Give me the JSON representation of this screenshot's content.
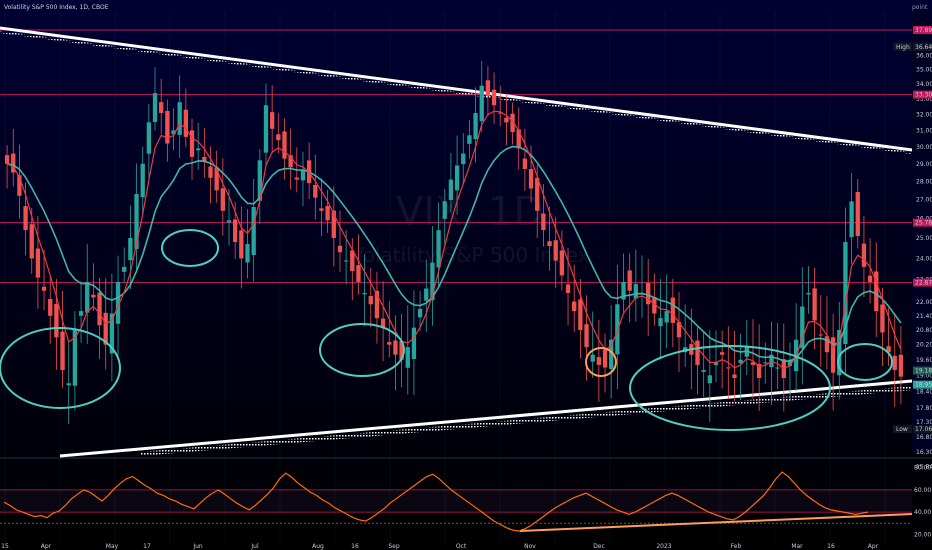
{
  "header": {
    "title": "Volatility S&P 500 Index, 1D, CBOE",
    "scale_label": "point"
  },
  "watermark": {
    "symbol": "VIX, 1D",
    "name": "Volatility S&P 500 Index"
  },
  "colors": {
    "bg_top": "#000033",
    "bg_bottom": "#000000",
    "candle_up": "#26a69a",
    "candle_down": "#ef5350",
    "ema_fast": "#f23645",
    "ema_slow": "#3fb8a5",
    "rsi": "#ff6d00",
    "hline": "#c2185b",
    "annot": "#4dd0c3",
    "annot_orange": "#ff9e59"
  },
  "chart_data": {
    "type": "candlestick",
    "title": "Volatility S&P 500 Index, 1D, CBOE",
    "y_range": [
      16.3,
      37.89
    ],
    "y_ticks": [
      36.64,
      36.0,
      35.0,
      34.0,
      33.3,
      33.0,
      32.0,
      31.0,
      30.0,
      29.0,
      28.0,
      27.0,
      26.0,
      25.0,
      24.0,
      23.0,
      22.0,
      21.4,
      20.8,
      20.2,
      19.6,
      19.0,
      18.4,
      17.8,
      17.3,
      16.8,
      16.3,
      15.84
    ],
    "x_ticks": [
      "15",
      "Apr",
      "May",
      "17",
      "Jun",
      "Jul",
      "Aug",
      "16",
      "Sep",
      "Oct",
      "Nov",
      "Dec",
      "2023",
      "Feb",
      "Mar",
      "16",
      "Apr"
    ],
    "badges": [
      {
        "value": "37.89",
        "kind": "hline"
      },
      {
        "label": "High",
        "value": "36.64",
        "kind": "high"
      },
      {
        "value": "33.30",
        "kind": "hline"
      },
      {
        "value": "25.78",
        "kind": "hline"
      },
      {
        "value": "22.87",
        "kind": "hline"
      },
      {
        "value": "19.18",
        "kind": "price"
      },
      {
        "value": "18.95",
        "kind": "last"
      },
      {
        "label": "Low",
        "value": "17.06",
        "kind": "low"
      }
    ],
    "horizontal_lines": [
      37.89,
      33.3,
      25.78,
      22.87
    ],
    "ohlc_close": [
      29.0,
      28.5,
      27.2,
      25.4,
      24.0,
      23.1,
      22.5,
      21.4,
      20.5,
      19.2,
      18.7,
      20.8,
      21.6,
      22.9,
      22.2,
      21.0,
      20.2,
      21.5,
      22.9,
      23.6,
      25.0,
      27.3,
      29.0,
      31.5,
      33.4,
      32.1,
      30.2,
      31.0,
      32.8,
      30.6,
      29.4,
      29.9,
      29.1,
      28.2,
      27.5,
      26.4,
      25.9,
      24.8,
      24.0,
      24.7,
      26.6,
      29.2,
      32.6,
      31.1,
      30.4,
      29.3,
      28.8,
      28.1,
      28.6,
      27.9,
      27.1,
      26.4,
      25.9,
      25.0,
      24.3,
      23.9,
      23.4,
      22.9,
      22.4,
      21.9,
      21.3,
      20.9,
      20.2,
      19.8,
      19.6,
      20.1,
      20.9,
      21.7,
      22.6,
      23.8,
      25.4,
      26.9,
      28.1,
      28.9,
      29.6,
      30.7,
      32.1,
      33.9,
      33.2,
      32.6,
      32.1,
      31.5,
      30.9,
      29.9,
      28.7,
      27.6,
      26.4,
      25.4,
      24.6,
      23.9,
      23.2,
      22.4,
      21.6,
      20.8,
      20.1,
      19.8,
      19.4,
      19.3,
      20.4,
      21.9,
      22.9,
      22.5,
      22.8,
      22.4,
      21.9,
      21.5,
      21.3,
      21.6,
      21.1,
      20.5,
      20.1,
      19.8,
      19.4,
      19.2,
      19.0,
      19.5,
      19.8,
      19.3,
      18.9,
      19.6,
      20.1,
      19.4,
      18.9,
      19.5,
      19.8,
      19.3,
      18.9,
      19.6,
      20.4,
      21.8,
      22.4,
      21.2,
      20.6,
      19.9,
      19.1,
      20.8,
      24.8,
      26.9,
      25.1,
      23.6,
      22.9,
      21.6,
      20.7,
      19.9,
      19.2,
      18.95
    ],
    "rsi": {
      "ticks": [
        80.0,
        60.0,
        40.0,
        20.0
      ],
      "values": [
        49,
        46,
        42,
        40,
        38,
        36,
        37,
        35,
        39,
        41,
        46,
        52,
        56,
        60,
        58,
        54,
        50,
        55,
        61,
        66,
        70,
        72,
        68,
        64,
        61,
        57,
        55,
        52,
        50,
        47,
        45,
        43,
        48,
        53,
        57,
        60,
        56,
        52,
        48,
        45,
        42,
        46,
        51,
        56,
        62,
        70,
        75,
        71,
        66,
        62,
        58,
        55,
        51,
        48,
        44,
        41,
        38,
        35,
        33,
        32,
        35,
        39,
        43,
        48,
        52,
        56,
        60,
        64,
        68,
        72,
        74,
        70,
        65,
        60,
        56,
        52,
        48,
        44,
        40,
        36,
        32,
        29,
        26,
        24,
        23,
        25,
        28,
        32,
        36,
        40,
        44,
        47,
        50,
        53,
        55,
        57,
        54,
        51,
        48,
        45,
        42,
        40,
        38,
        40,
        43,
        46,
        49,
        52,
        55,
        57,
        55,
        52,
        49,
        46,
        43,
        40,
        38,
        36,
        34,
        33,
        36,
        40,
        45,
        50,
        55,
        62,
        70,
        76,
        72,
        66,
        60,
        55,
        51,
        47,
        44,
        42,
        41,
        40,
        39,
        38,
        39,
        40
      ]
    }
  }
}
